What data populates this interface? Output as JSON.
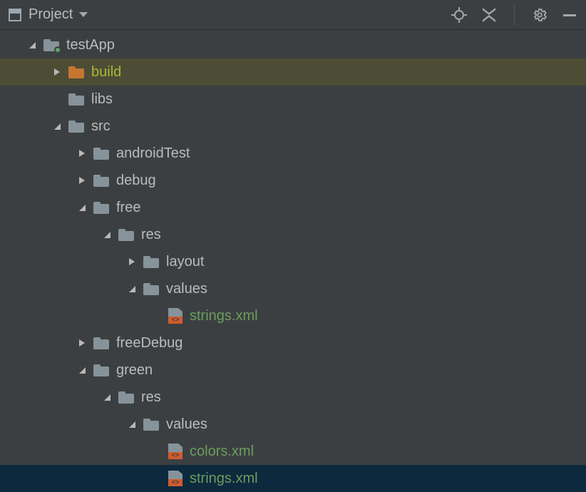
{
  "toolbar": {
    "title": "Project"
  },
  "tree": {
    "testApp": "testApp",
    "build": "build",
    "libs": "libs",
    "src": "src",
    "androidTest": "androidTest",
    "debug": "debug",
    "free": "free",
    "res1": "res",
    "layout": "layout",
    "values1": "values",
    "strings1": "strings.xml",
    "freeDebug": "freeDebug",
    "green": "green",
    "res2": "res",
    "values2": "values",
    "colors": "colors.xml",
    "strings2": "strings.xml"
  },
  "colors": {
    "olive": "#a9b837",
    "green": "#6a9e5e",
    "grey": "#bbbbbb",
    "folderGrey": "#87939a",
    "folderOrange": "#c57633"
  }
}
